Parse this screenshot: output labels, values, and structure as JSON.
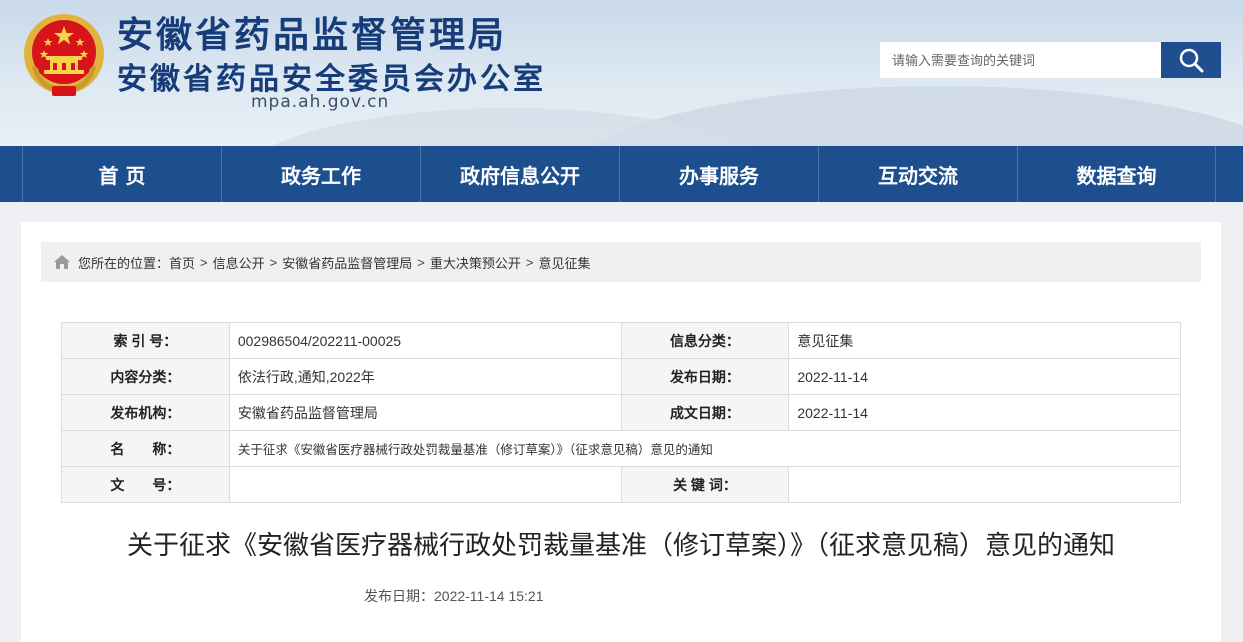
{
  "header": {
    "title_line1": "安徽省药品监督管理局",
    "title_line2": "安徽省药品安全委员会办公室",
    "domain": "mpa.ah.gov.cn",
    "search_placeholder": "请输入需要查询的关键词",
    "emblem_icon": "national-emblem-icon",
    "search_icon": "magnifier-icon"
  },
  "nav": {
    "items": [
      {
        "label": "首 页"
      },
      {
        "label": "政务工作"
      },
      {
        "label": "政府信息公开"
      },
      {
        "label": "办事服务"
      },
      {
        "label": "互动交流"
      },
      {
        "label": "数据查询"
      }
    ]
  },
  "breadcrumb": {
    "prefix": "您所在的位置：",
    "items": [
      "首页",
      "信息公开",
      "安徽省药品监督管理局",
      "重大决策预公开",
      "意见征集"
    ],
    "separator": ">"
  },
  "meta": {
    "index_label": "索 引 号：",
    "index_value": "002986504/202211-00025",
    "category_label": "信息分类：",
    "category_value": "意见征集",
    "content_type_label": "内容分类：",
    "content_type_value": "依法行政,通知,2022年",
    "publish_date_label": "发布日期：",
    "publish_date_value": "2022-11-14",
    "publisher_label": "发布机构：",
    "publisher_value": "安徽省药品监督管理局",
    "creation_date_label": "成文日期：",
    "creation_date_value": "2022-11-14",
    "name_label": "名　　称：",
    "name_value": "关于征求《安徽省医疗器械行政处罚裁量基准（修订草案）》（征求意见稿）意见的通知",
    "doc_no_label": "文　　号：",
    "doc_no_value": "",
    "keywords_label": "关 键 词：",
    "keywords_value": ""
  },
  "article": {
    "title": "关于征求《安徽省医疗器械行政处罚裁量基准（修订草案）》（征求意见稿）意见的通知",
    "date_text": "发布日期：2022-11-14 15:21"
  },
  "colors": {
    "nav_bg": "#1d4f8f",
    "title_blue": "#163d7a",
    "emblem_red": "#d7141a",
    "emblem_gold": "#f2c94c"
  }
}
